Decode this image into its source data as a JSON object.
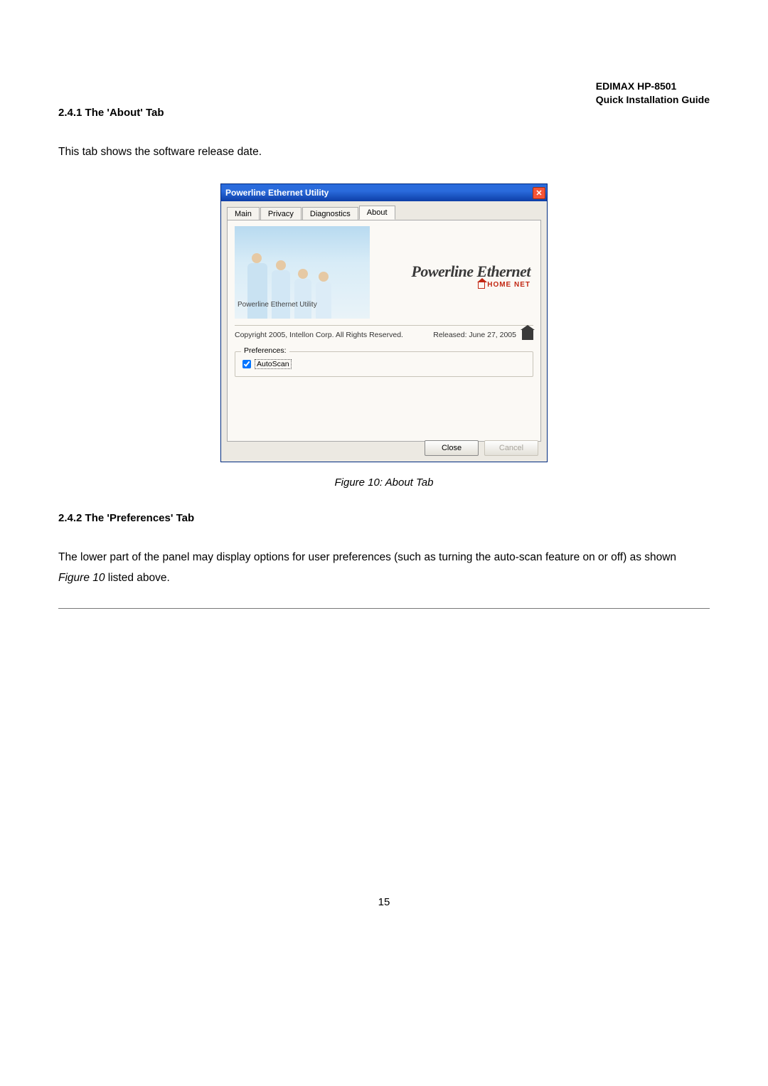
{
  "header": {
    "product": "EDIMAX  HP-8501",
    "doc": "Quick Installation Guide"
  },
  "sections": {
    "s241": {
      "num": "2.4.1",
      "title": "The 'About' Tab",
      "body": "This tab shows the software release date."
    },
    "s242": {
      "num": "2.4.2",
      "title": "The 'Preferences' Tab",
      "body_a": "The lower part of the panel may display options for user preferences (such as turning the auto-scan feature on or off) as shown ",
      "body_ref": "Figure 10",
      "body_b": " listed above."
    }
  },
  "figure": {
    "caption": "Figure 10: About Tab"
  },
  "page_number": "15",
  "dialog": {
    "title": "Powerline Ethernet Utility",
    "tabs": {
      "main": "Main",
      "privacy": "Privacy",
      "diagnostics": "Diagnostics",
      "about": "About"
    },
    "brand_main": "Powerline Ethernet",
    "brand_sub": "HOME NET",
    "product_line": "Powerline Ethernet Utility",
    "copyright": "Copyright  2005, Intellon Corp. All Rights Reserved.",
    "released": "Released: June 27, 2005",
    "prefs_legend": "Preferences:",
    "autoscan_label": "AutoScan",
    "close": "Close",
    "cancel": "Cancel"
  }
}
